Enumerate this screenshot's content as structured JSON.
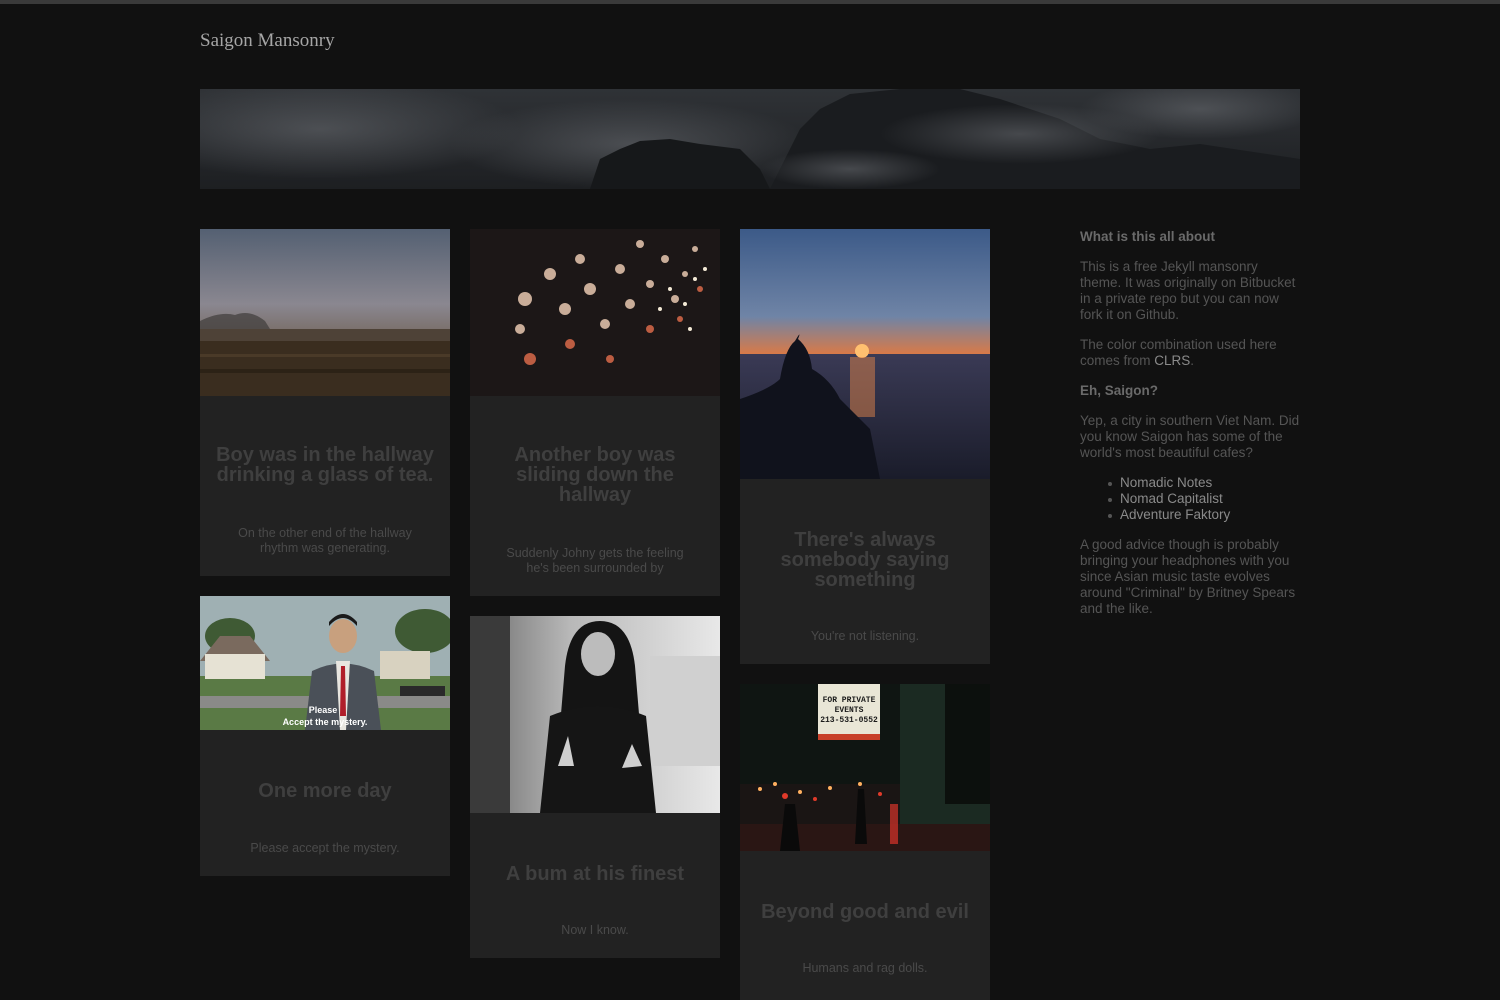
{
  "site": {
    "title": "Saigon Mansonry"
  },
  "cards": [
    {
      "title": "Boy was in the hallway drinking a glass of tea.",
      "excerpt": "On the other end of the hallway rhythm was generating."
    },
    {
      "title": "Another boy was sliding down the hallway",
      "excerpt": "Suddenly Johny gets the feeling he's been surrounded by"
    },
    {
      "title": "There's always somebody saying something",
      "excerpt": "You're not listening."
    },
    {
      "title": "One more day",
      "excerpt": "Please accept the mystery.",
      "image_caption": [
        "Please",
        "Accept the mystery."
      ]
    },
    {
      "title": "A bum at his finest",
      "excerpt": "Now I know."
    },
    {
      "title": "Beyond good and evil",
      "excerpt": "Humans and rag dolls.",
      "image_sign": [
        "FOR PRIVATE",
        "EVENTS",
        "213-531-0552"
      ]
    }
  ],
  "sidebar": {
    "heading1": "What is this all about",
    "para1": "This is a free Jekyll mansonry theme. It was originally on Bitbucket in a private repo but you can now fork it on Github.",
    "para2_prefix": "The color combination used here comes from ",
    "para2_link": "CLRS",
    "para2_suffix": ".",
    "heading2": "Eh, Saigon?",
    "para3": "Yep, a city in southern Viet Nam. Did you know Saigon has some of the world's most beautiful cafes?",
    "links": [
      "Nomadic Notes",
      "Nomad Capitalist",
      "Adventure Faktory"
    ],
    "para4": "A good advice though is probably bringing your headphones with you since Asian music taste evolves around \"Criminal\" by Britney Spears and the like."
  }
}
